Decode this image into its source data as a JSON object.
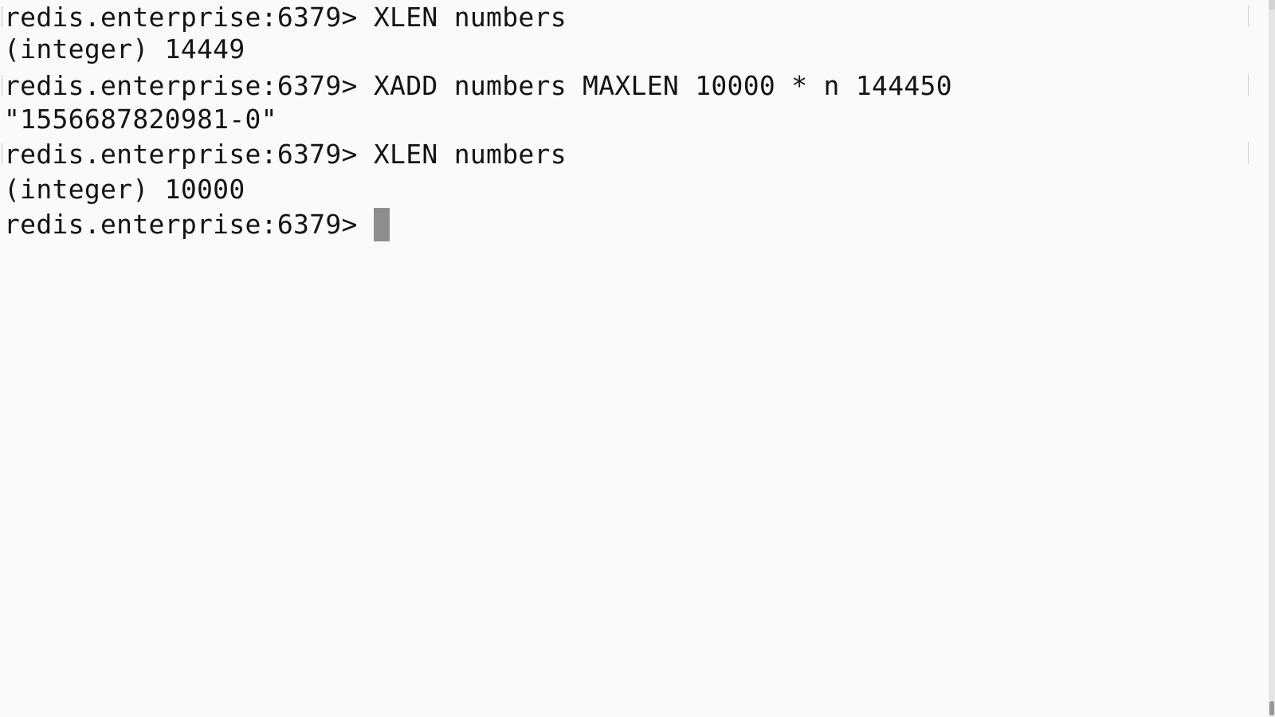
{
  "terminal": {
    "lines": [
      {
        "kind": "command",
        "text": "redis.enterprise:6379> XLEN numbers"
      },
      {
        "kind": "output",
        "text": "(integer) 14449"
      },
      {
        "kind": "command",
        "text": "redis.enterprise:6379> XADD numbers MAXLEN 10000 * n 144450"
      },
      {
        "kind": "output",
        "text": "\"1556687820981-0\""
      },
      {
        "kind": "command",
        "text": "redis.enterprise:6379> XLEN numbers"
      },
      {
        "kind": "output",
        "text": "(integer) 10000"
      }
    ],
    "current_prompt": "redis.enterprise:6379> "
  },
  "colors": {
    "background": "#fcf9fc",
    "text": "#141414",
    "cursor": "#8e8c8e"
  }
}
